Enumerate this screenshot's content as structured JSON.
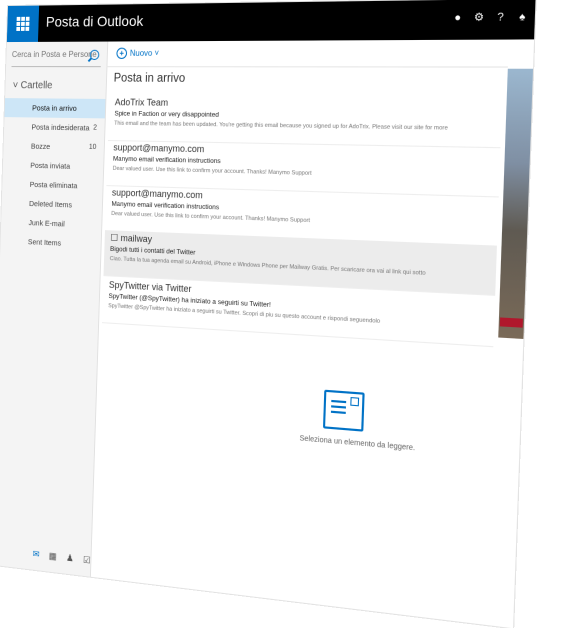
{
  "app": {
    "title": "Posta di Outlook"
  },
  "search": {
    "placeholder": "Cerca in Posta e Persone"
  },
  "folders": {
    "heading": "Cartelle",
    "items": [
      {
        "label": "Posta in arrivo",
        "count": ""
      },
      {
        "label": "Posta indesiderata",
        "count": "2"
      },
      {
        "label": "Bozze",
        "count": "10"
      },
      {
        "label": "Posta inviata",
        "count": ""
      },
      {
        "label": "Posta eliminata",
        "count": ""
      },
      {
        "label": "Deleted Items",
        "count": ""
      },
      {
        "label": "Junk E-mail",
        "count": ""
      },
      {
        "label": "Sent Items",
        "count": ""
      }
    ]
  },
  "toolbar": {
    "new_label": "Nuovo"
  },
  "inbox": {
    "title": "Posta in arrivo",
    "messages": [
      {
        "from": "AdoTrix Team",
        "subject": "Spice in Faction or very disappointed",
        "preview": "This email and the team has been updated. You're getting this email because you signed up for AdoTrix. Please visit our site for more",
        "time": ""
      },
      {
        "from": "support@manymo.com",
        "subject": "Manymo email verification instructions",
        "preview": "Dear valued user. Use this link to confirm your account. Thanks! Manymo Support",
        "time": ""
      },
      {
        "from": "support@manymo.com",
        "subject": "Manymo email verification instructions",
        "preview": "Dear valued user. Use this link to confirm your account. Thanks! Manymo Support",
        "time": ""
      },
      {
        "from": "mailway",
        "subject": "Bigodi tutti i contatti del Twitter",
        "preview": "Ciao. Tutta la tua agenda email su Android, iPhone e Windows Phone per Mailway Gratis. Per scaricare ora vai al link qui sotto",
        "time": ""
      },
      {
        "from": "SpyTwitter via Twitter",
        "subject": "SpyTwitter (@SpyTwitter) ha iniziato a seguirti su Twitter!",
        "preview": "SpyTwitter @SpyTwitter ha iniziato a seguirti su Twitter. Scopri di piu su questo account e rispondi seguendolo",
        "time": ""
      }
    ]
  },
  "reading_pane": {
    "empty_text": "Seleziona un elemento da leggere."
  },
  "footer": {
    "icons": [
      "mail-icon",
      "calendar-icon",
      "people-icon",
      "tasks-icon"
    ]
  }
}
